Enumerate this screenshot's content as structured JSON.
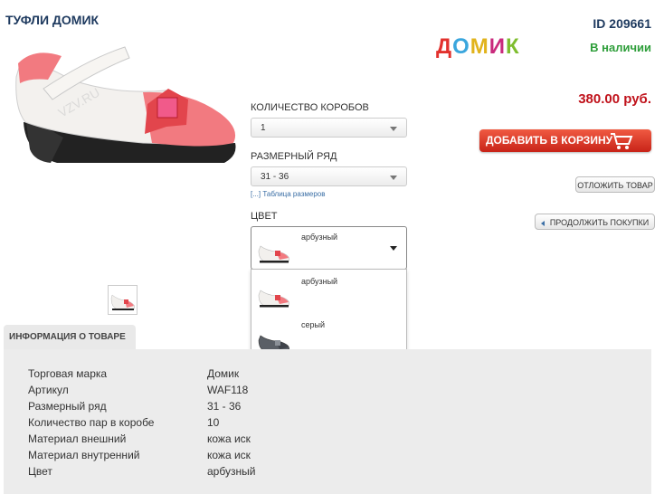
{
  "product": {
    "title": "ТУФЛИ ДОМИК",
    "id": "ID 209661",
    "brand_letters": [
      "Д",
      "О",
      "М",
      "И",
      "К"
    ],
    "brand_colors": [
      "#e2312d",
      "#3aa6dd",
      "#e1b31c",
      "#c92a7c",
      "#7ebd2e"
    ],
    "stock": "В наличии",
    "price": "380.00 руб.",
    "watermark": "VZV.RU"
  },
  "actions": {
    "add_to_cart": "ДОБАВИТЬ В КОРЗИНУ",
    "defer": "ОТЛОЖИТЬ ТОВАР",
    "continue": "ПРОДОЛЖИТЬ ПОКУПКИ"
  },
  "options": {
    "boxes_label": "КОЛИЧЕСТВО КОРОБОВ",
    "boxes_value": "1",
    "size_label": "РАЗМЕРНЫЙ РЯД",
    "size_value": "31 - 36",
    "size_table_link": "[...] Таблица размеров",
    "color_label": "ЦВЕТ",
    "color_value": "арбузный",
    "color_options": [
      "арбузный",
      "серый"
    ]
  },
  "info": {
    "tab": "ИНФОРМАЦИЯ О ТОВАРЕ",
    "rows": [
      [
        "Торговая марка",
        "Домик"
      ],
      [
        "Артикул",
        "WAF118"
      ],
      [
        "Размерный ряд",
        "31 - 36"
      ],
      [
        "Количество пар в коробе",
        "10"
      ],
      [
        "Материал внешний",
        "кожа иск"
      ],
      [
        "Материал внутренний",
        "кожа иск"
      ],
      [
        "Цвет",
        "арбузный"
      ]
    ]
  },
  "colors": {
    "accent_red": "#c0121b",
    "stock_green": "#2e9e3a",
    "title_blue": "#1e3a5f"
  }
}
